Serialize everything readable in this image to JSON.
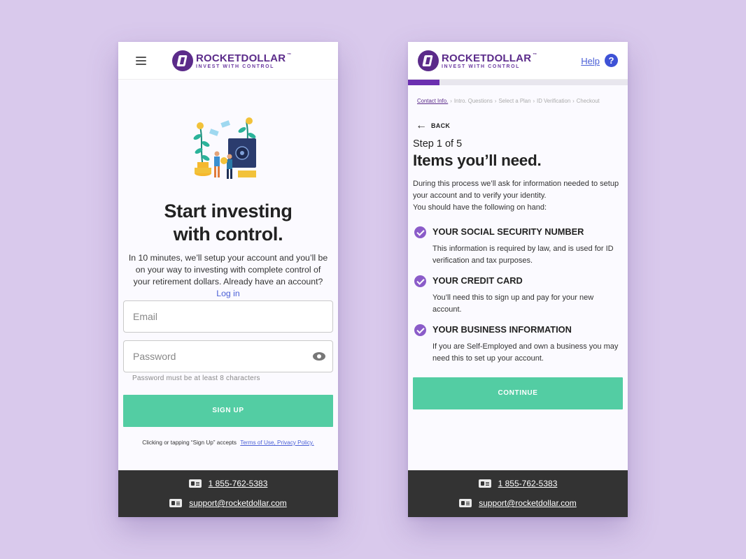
{
  "colors": {
    "background": "#d9c9ec",
    "brand_purple": "#5b2b8a",
    "accent_green": "#53cda3",
    "link_blue": "#4a5fd6",
    "footer": "#333333"
  },
  "brand": {
    "name": "ROCKETDOLLAR",
    "tm": "™",
    "tagline": "INVEST WITH CONTROL"
  },
  "signup": {
    "menu_icon": "hamburger-icon",
    "title_line1": "Start investing",
    "title_line2": "with control.",
    "subtitle": "In 10 minutes, we’ll setup your account and you’ll be on your way to investing with complete control of your retirement dollars. Already have an account?",
    "login_link": "Log in",
    "email_placeholder": "Email",
    "password_placeholder": "Password",
    "password_hint": "Password must be at least 8 characters",
    "signup_button": "SIGN UP",
    "terms_text": "Clicking or tapping “Sign Up” accepts",
    "terms_link": "Terms of Use, Privacy Policy."
  },
  "checklist": {
    "help_label": "Help",
    "help_icon": "?",
    "progress": 0.143,
    "breadcrumbs": [
      "Contact Info.",
      "Intro. Questions",
      "Select a Plan",
      "ID Verification",
      "Checkout"
    ],
    "breadcrumb_sep": "›",
    "back_label": "BACK",
    "step": "Step 1 of 5",
    "title": "Items you’ll need.",
    "intro_line1": "During this process we’ll ask for information needed to setup your account and to verify your identity.",
    "intro_line2": "You should have the following on hand:",
    "items": [
      {
        "title": "YOUR SOCIAL SECURITY NUMBER",
        "desc": "This information is required by law, and is used for ID verification and tax purposes."
      },
      {
        "title": "YOUR CREDIT CARD",
        "desc": "You’ll need this to sign up and pay for your new account."
      },
      {
        "title": "YOUR BUSINESS INFORMATION",
        "desc": "If you are Self-Employed and own a business you may need this to set up your account."
      }
    ],
    "continue_button": "CONTINUE"
  },
  "footer": {
    "phone": "1 855-762-5383",
    "email": "support@rocketdollar.com"
  }
}
